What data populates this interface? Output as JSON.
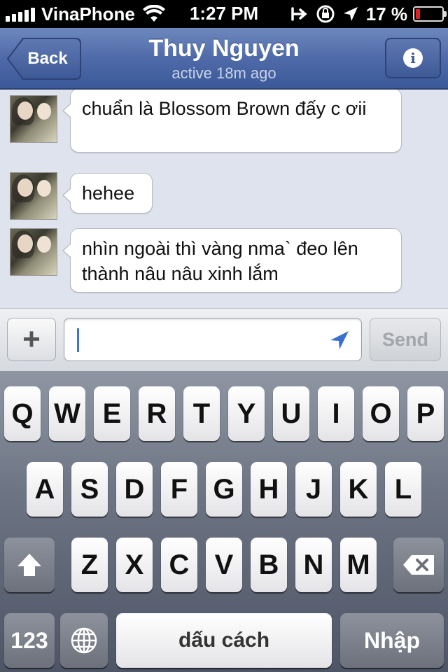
{
  "status_bar": {
    "carrier": "VinaPhone",
    "time": "1:27 PM",
    "battery_percent": "17 %",
    "battery_level": 0.17,
    "icons": [
      "signal-icon",
      "wifi-icon",
      "call-forward-icon",
      "rotation-lock-icon",
      "location-arrow-icon",
      "battery-icon"
    ]
  },
  "nav": {
    "back_label": "Back",
    "title": "Thuy Nguyen",
    "subtitle": "active 18m ago",
    "info_icon": "i"
  },
  "messages": [
    {
      "text": "chuẩn là Blossom Brown đấy c ơii"
    },
    {
      "text": "hehee"
    },
    {
      "text": "nhìn ngoài thì vàng nma` đeo lên thành nâu nâu xinh lắm"
    }
  ],
  "compose": {
    "plus_label": "+",
    "input_value": "",
    "send_label": "Send"
  },
  "keyboard": {
    "row1": [
      "Q",
      "W",
      "E",
      "R",
      "T",
      "Y",
      "U",
      "I",
      "O",
      "P"
    ],
    "row2": [
      "A",
      "S",
      "D",
      "F",
      "G",
      "H",
      "J",
      "K",
      "L"
    ],
    "row3": [
      "Z",
      "X",
      "C",
      "V",
      "B",
      "N",
      "M"
    ],
    "numbers_label": "123",
    "space_label": "dấu cách",
    "return_label": "Nhập"
  },
  "colors": {
    "nav_blue": "#3b5998",
    "chat_bg": "#dfe3ee",
    "caret": "#3a73d9",
    "battery_low": "#e02020"
  }
}
